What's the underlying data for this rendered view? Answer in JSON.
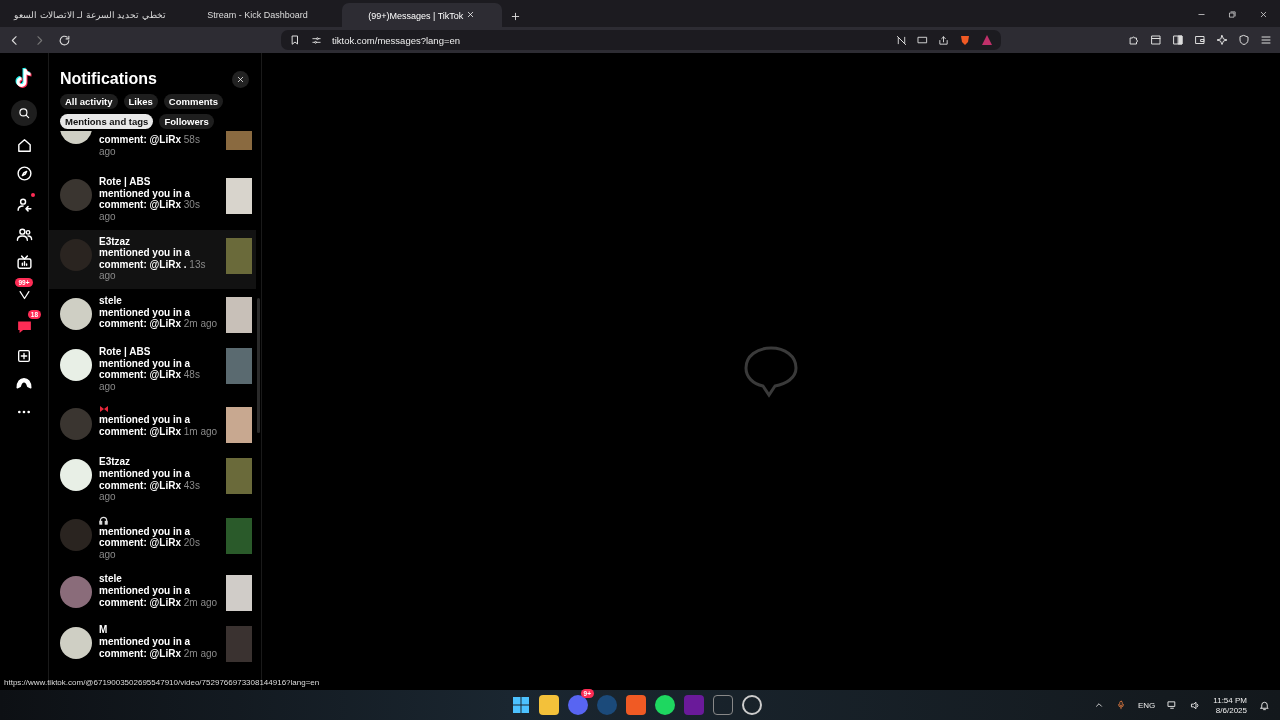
{
  "browser": {
    "tabs": [
      {
        "title": "تخطي تحديد السرعة لـ الاتصالات السعو",
        "selected": false
      },
      {
        "title": "Stream - Kick Dashboard",
        "selected": false
      },
      {
        "title": "(99+)Messages | TikTok",
        "selected": true
      }
    ],
    "address": "tiktok.com/messages?lang=en"
  },
  "rail": {
    "inbox_badge": "99+",
    "messages_badge": "18"
  },
  "notifications": {
    "title": "Notifications",
    "filters": [
      {
        "label": "All activity",
        "selected": false
      },
      {
        "label": "Likes",
        "selected": false
      },
      {
        "label": "Comments",
        "selected": false
      },
      {
        "label": "Mentions and tags",
        "selected": true
      },
      {
        "label": "Followers",
        "selected": false
      }
    ],
    "items": [
      {
        "kind": "partial",
        "text": "comment: @LiRx",
        "time": "58s ago",
        "hovered": false
      },
      {
        "kind": "text",
        "name": "Rote | ABS",
        "text": "mentioned you in a comment: @LiRx",
        "time": "30s ago",
        "hovered": false
      },
      {
        "kind": "text",
        "name": "E3tzaz",
        "text": "mentioned you in a comment: @LiRx .",
        "time": "13s ago",
        "hovered": true
      },
      {
        "kind": "text",
        "name": "stele",
        "text": "mentioned you in a comment: @LiRx",
        "time": "2m ago",
        "hovered": false
      },
      {
        "kind": "text",
        "name": "Rote | ABS",
        "text": "mentioned you in a comment: @LiRx",
        "time": "48s ago",
        "hovered": false
      },
      {
        "kind": "bow",
        "text": "mentioned you in a comment: @LiRx",
        "time": "1m ago",
        "hovered": false
      },
      {
        "kind": "text",
        "name": "E3tzaz",
        "text": "mentioned you in a comment: @LiRx",
        "time": "43s ago",
        "hovered": false
      },
      {
        "kind": "headphones",
        "text": "mentioned you in a comment: @LiRx",
        "time": "20s ago",
        "hovered": false
      },
      {
        "kind": "text",
        "name": "stele",
        "text": "mentioned you in a comment: @LiRx",
        "time": "2m ago",
        "hovered": false
      },
      {
        "kind": "text",
        "name": "M",
        "text": "mentioned you in a comment: @LiRx",
        "time": "2m ago",
        "hovered": false
      }
    ]
  },
  "status_url": "https://www.tiktok.com/@6719003502695547910/video/7529766973308144916?lang=en",
  "taskbar": {
    "discord_badge": "9+",
    "language": "ENG",
    "time": "11:54 PM",
    "date": "8/6/2025"
  }
}
